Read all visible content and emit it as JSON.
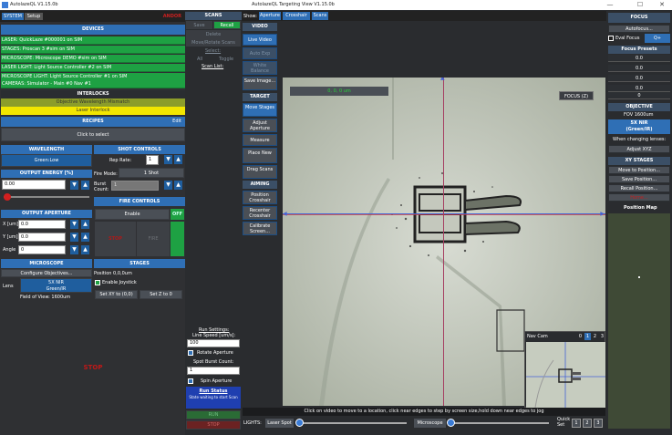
{
  "left_window": {
    "title": "AutolazeQL V1.15.0b",
    "menu": {
      "system": "SYSTEM",
      "setup": "Setup",
      "logo": "ANDOR"
    },
    "devices": {
      "header": "DEVICES",
      "items": [
        "LASER: QuickLaze #000001 on SIM",
        "STAGES: Proscan 3 #sim on SIM",
        "MICROSCOPE: Microscope DEMO #sim on SIM",
        "LASER LIGHT: Light Source Controller #2 on SIM",
        "MICROSCOPE LIGHT: Light Source Controller #1 on SIM",
        "CAMERAS: Simulator - Main #0 Nav #1"
      ]
    },
    "interlocks": {
      "header": "INTERLOCKS",
      "items": [
        "Objective Wavelength Mismatch",
        "Laser Interlock"
      ]
    },
    "recipes": {
      "header": "RECIPES",
      "edit": "Edit",
      "select": "Click to select"
    },
    "wavelength": {
      "header": "WAVELENGTH",
      "value": "Green:Low"
    },
    "output_energy": {
      "header": "OUTPUT ENERGY [%]",
      "value": "0.00"
    },
    "output_aperture": {
      "header": "OUTPUT APERTURE",
      "x_label": "X [um]",
      "x_value": "0.0",
      "y_label": "Y [um]",
      "y_value": "0.0",
      "angle_label": "Angle",
      "angle_value": "0"
    },
    "shot_controls": {
      "header": "SHOT CONTROLS",
      "rep_rate_label": "Rep Rate:",
      "rep_rate_value": "1",
      "fire_mode_label": "Fire Mode:",
      "fire_mode_value": "1 Shot",
      "burst_label": "Burst Count:",
      "burst_value": "1"
    },
    "fire_controls": {
      "header": "FIRE CONTROLS",
      "enable": "Enable",
      "off": "OFF",
      "stop": "STOP",
      "fire": "FIRE"
    },
    "microscope": {
      "header": "MICROSCOPE",
      "configure": "Configure Objectives...",
      "lens_label": "Lens",
      "lens_value": "5X NIR",
      "lens_value2": "Green/IR",
      "fov": "Field of View: 1600um"
    },
    "stages": {
      "header": "STAGES",
      "position": "Position 0,0,0um",
      "joystick": "Enable Joystick",
      "set_xy": "Set XY to (0,0)",
      "set_z": "Set Z to 0"
    },
    "big_stop": "STOP"
  },
  "scans": {
    "header": "SCANS",
    "save": "Save",
    "recall": "Recall",
    "delete": "Delete",
    "move_rotate": "Move/Rotate Scans",
    "select": "Select:",
    "all": "All",
    "toggle": "Toggle",
    "scan_list": "Scan List:",
    "run_settings": "Run Settings:",
    "line_speed_label": "Line Speed [um/s]:",
    "line_speed_value": "100",
    "rotate_aperture": "Rotate Aperture",
    "spot_burst_label": "Spot Burst Count:",
    "spot_burst_value": "1",
    "spin_aperture": "Spin Aperture",
    "run_status": "Run Status",
    "run_status_text": "State waiting to start Scan",
    "run": "RUN",
    "stop": "STOP"
  },
  "targeting": {
    "title": "AutolazeQL Targeting View V1.15.0b",
    "show_label": "Show:",
    "show_tabs": [
      "Aperture",
      "Crosshair",
      "Scans"
    ],
    "video_header": "VIDEO",
    "live_video": "Live Video",
    "auto_exp": "Auto Exp",
    "white_balance": "White Balance",
    "save_image": "Save Image...",
    "target_header": "TARGET",
    "move_stages": "Move Stages",
    "adjust_aperture": "Adjust Aperture",
    "measure": "Measure",
    "place_new": "Place New",
    "drag_scans": "Drag Scans",
    "aiming_header": "AIMING",
    "position_crosshair": "Position Crosshair",
    "recenter_crosshair": "Recenter Crosshair",
    "calibrate_screen": "Calibrate Screen...",
    "coord_readout": "0, 0, 0 um",
    "focus_badge": "FOCUS (Z)",
    "nav_cam": {
      "label": "Nav Cam",
      "zoom": [
        "0",
        "1",
        "2",
        "3"
      ]
    },
    "hint": "Click on video to move to a location, click near edges to step by screen size,hold down near edges to jog",
    "lights_label": "LIGHTS:",
    "laser_spot": "Laser Spot",
    "microscope": "Microscope",
    "quick_set": "Quick Set",
    "quick_buttons": [
      "1",
      "2",
      "3"
    ]
  },
  "focus": {
    "header": "FOCUS",
    "autofocus": "Autofocus...",
    "eval_focus": "Eval Focus",
    "q_plus": "Q+",
    "presets_header": "Focus Presets",
    "presets": [
      "0.0",
      "0.0",
      "0.0",
      "0.0",
      "0"
    ],
    "objective_header": "OBJECTIVE",
    "fov": "FOV 1600um",
    "lens": "5X NIR",
    "lens2": "(Green/IR)",
    "when_changing": "When changing lenses:",
    "adjust_xyz": "Adjust XYZ",
    "xy_header": "XY STAGES",
    "move_to": "Move to Position...",
    "save_pos": "Save Position...",
    "recall_pos": "Recall Position...",
    "home": "Home...",
    "position_map": "Position Map"
  },
  "colors": {
    "accent": "#2f6fb5",
    "green": "#1ea143",
    "yellow": "#f2e600",
    "red": "#d21f1f"
  }
}
